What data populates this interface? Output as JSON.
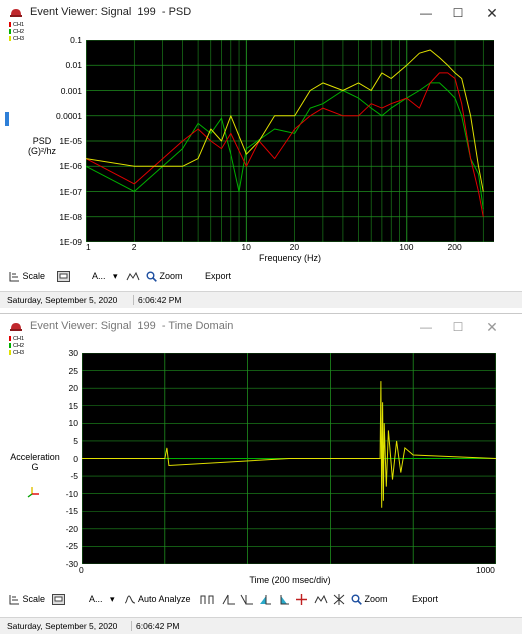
{
  "psd_window": {
    "title": "Event Viewer: Signal  199  - PSD",
    "legend": [
      {
        "label": "CH1",
        "color": "#e00000"
      },
      {
        "label": "CH2",
        "color": "#00b000"
      },
      {
        "label": "CH3",
        "color": "#e0e000"
      }
    ],
    "y_axis": {
      "label_line1": "PSD",
      "label_line2": "(G)²/hz",
      "ticks": [
        "0.1",
        "0.01",
        "0.001",
        "0.0001",
        "1E-05",
        "1E-06",
        "1E-07",
        "1E-08",
        "1E-09"
      ]
    },
    "x_axis": {
      "label": "Frequency (Hz)",
      "ticks": [
        "1",
        "2",
        "10",
        "20",
        "100",
        "200"
      ]
    },
    "toolbar": {
      "scale": "Scale",
      "analyze_short": "A...",
      "zoom": "Zoom",
      "export": "Export"
    },
    "status": {
      "date": "Saturday, September 5, 2020",
      "time": "6:06:42 PM"
    }
  },
  "time_window": {
    "title": "Event Viewer: Signal  199  - Time Domain",
    "legend": [
      {
        "label": "CH1",
        "color": "#e00000"
      },
      {
        "label": "CH2",
        "color": "#00b000"
      },
      {
        "label": "CH3",
        "color": "#e0e000"
      }
    ],
    "y_axis": {
      "label_line1": "Acceleration",
      "label_line2": "G",
      "ticks": [
        "30",
        "25",
        "20",
        "15",
        "10",
        "5",
        "0",
        "-5",
        "-10",
        "-15",
        "-20",
        "-25",
        "-30"
      ]
    },
    "x_axis": {
      "label": "Time (200 msec/div)",
      "tick_start": "0",
      "tick_end": "1000"
    },
    "toolbar": {
      "scale": "Scale",
      "analyze_short": "A...",
      "auto_analyze": "Auto Analyze",
      "zoom": "Zoom",
      "export": "Export"
    },
    "status": {
      "date": "Saturday, September 5, 2020",
      "time": "6:06:42 PM"
    }
  },
  "chart_data": [
    {
      "type": "line",
      "x_scale": "log",
      "y_scale": "log",
      "xlabel": "Frequency (Hz)",
      "ylabel": "PSD (G)²/hz",
      "xlim": [
        1,
        350
      ],
      "ylim": [
        1e-09,
        0.1
      ],
      "grid": true,
      "legend": "top-left",
      "series": [
        {
          "name": "CH1",
          "color": "#e00000",
          "x": [
            1,
            2,
            4,
            5,
            6,
            7,
            8,
            10,
            12,
            15,
            20,
            25,
            30,
            40,
            50,
            60,
            70,
            80,
            100,
            120,
            140,
            160,
            180,
            200,
            220,
            250,
            280,
            300
          ],
          "y": [
            2e-06,
            2e-07,
            1e-05,
            3e-05,
            1e-05,
            5e-06,
            2e-05,
            1e-06,
            1e-05,
            2e-06,
            3e-05,
            0.0001,
            0.0002,
            0.0001,
            0.0001,
            0.0003,
            0.0002,
            0.0003,
            0.0005,
            0.0002,
            0.002,
            0.005,
            0.005,
            0.003,
            0.0003,
            2e-06,
            1e-07,
            1e-08
          ]
        },
        {
          "name": "CH2",
          "color": "#00b000",
          "x": [
            1,
            2,
            4,
            5,
            6,
            7,
            8,
            9,
            10,
            15,
            20,
            25,
            30,
            40,
            50,
            60,
            70,
            80,
            100,
            120,
            140,
            160,
            180,
            200,
            220,
            250,
            280,
            300
          ],
          "y": [
            1e-06,
            1e-07,
            5e-06,
            5e-05,
            2e-05,
            8e-05,
            3e-06,
            1e-07,
            5e-06,
            3e-05,
            2e-05,
            0.0002,
            0.0003,
            0.001,
            0.0005,
            0.0002,
            0.0001,
            0.0002,
            0.0005,
            0.001,
            0.002,
            0.002,
            0.001,
            0.0005,
            0.0001,
            2e-06,
            5e-07,
            2e-08
          ]
        },
        {
          "name": "CH3",
          "color": "#e0e000",
          "x": [
            1,
            2,
            4,
            5,
            6,
            7,
            8,
            10,
            12,
            15,
            20,
            25,
            30,
            40,
            50,
            60,
            70,
            80,
            100,
            120,
            140,
            160,
            180,
            200,
            220,
            250,
            280,
            300
          ],
          "y": [
            2e-06,
            1e-06,
            1e-06,
            2e-06,
            3e-05,
            1e-05,
            0.0001,
            3e-06,
            1e-05,
            0.0001,
            0.0001,
            0.001,
            0.002,
            0.001,
            0.002,
            0.001,
            0.005,
            0.003,
            0.01,
            0.03,
            0.04,
            0.02,
            0.01,
            0.005,
            0.003,
            0.0001,
            1e-06,
            1e-07
          ]
        }
      ]
    },
    {
      "type": "line",
      "xlabel": "Time (200 msec/div)",
      "ylabel": "Acceleration G",
      "xlim": [
        0,
        1000
      ],
      "ylim": [
        -30,
        30
      ],
      "grid": true,
      "legend": "top-left",
      "series": [
        {
          "name": "CH1",
          "color": "#e00000",
          "x": [
            0,
            1000
          ],
          "y": [
            0,
            0
          ]
        },
        {
          "name": "CH2",
          "color": "#00b000",
          "x": [
            0,
            1000
          ],
          "y": [
            0,
            0
          ]
        },
        {
          "name": "CH3",
          "color": "#e0e000",
          "x": [
            0,
            200,
            205,
            210,
            500,
            720,
            722,
            724,
            726,
            728,
            730,
            735,
            740,
            750,
            760,
            770,
            780,
            800,
            1000
          ],
          "y": [
            0,
            0,
            3,
            -2,
            0,
            0,
            22,
            -14,
            16,
            -12,
            10,
            -8,
            8,
            -6,
            5,
            -4,
            3,
            1,
            0
          ]
        }
      ]
    }
  ]
}
